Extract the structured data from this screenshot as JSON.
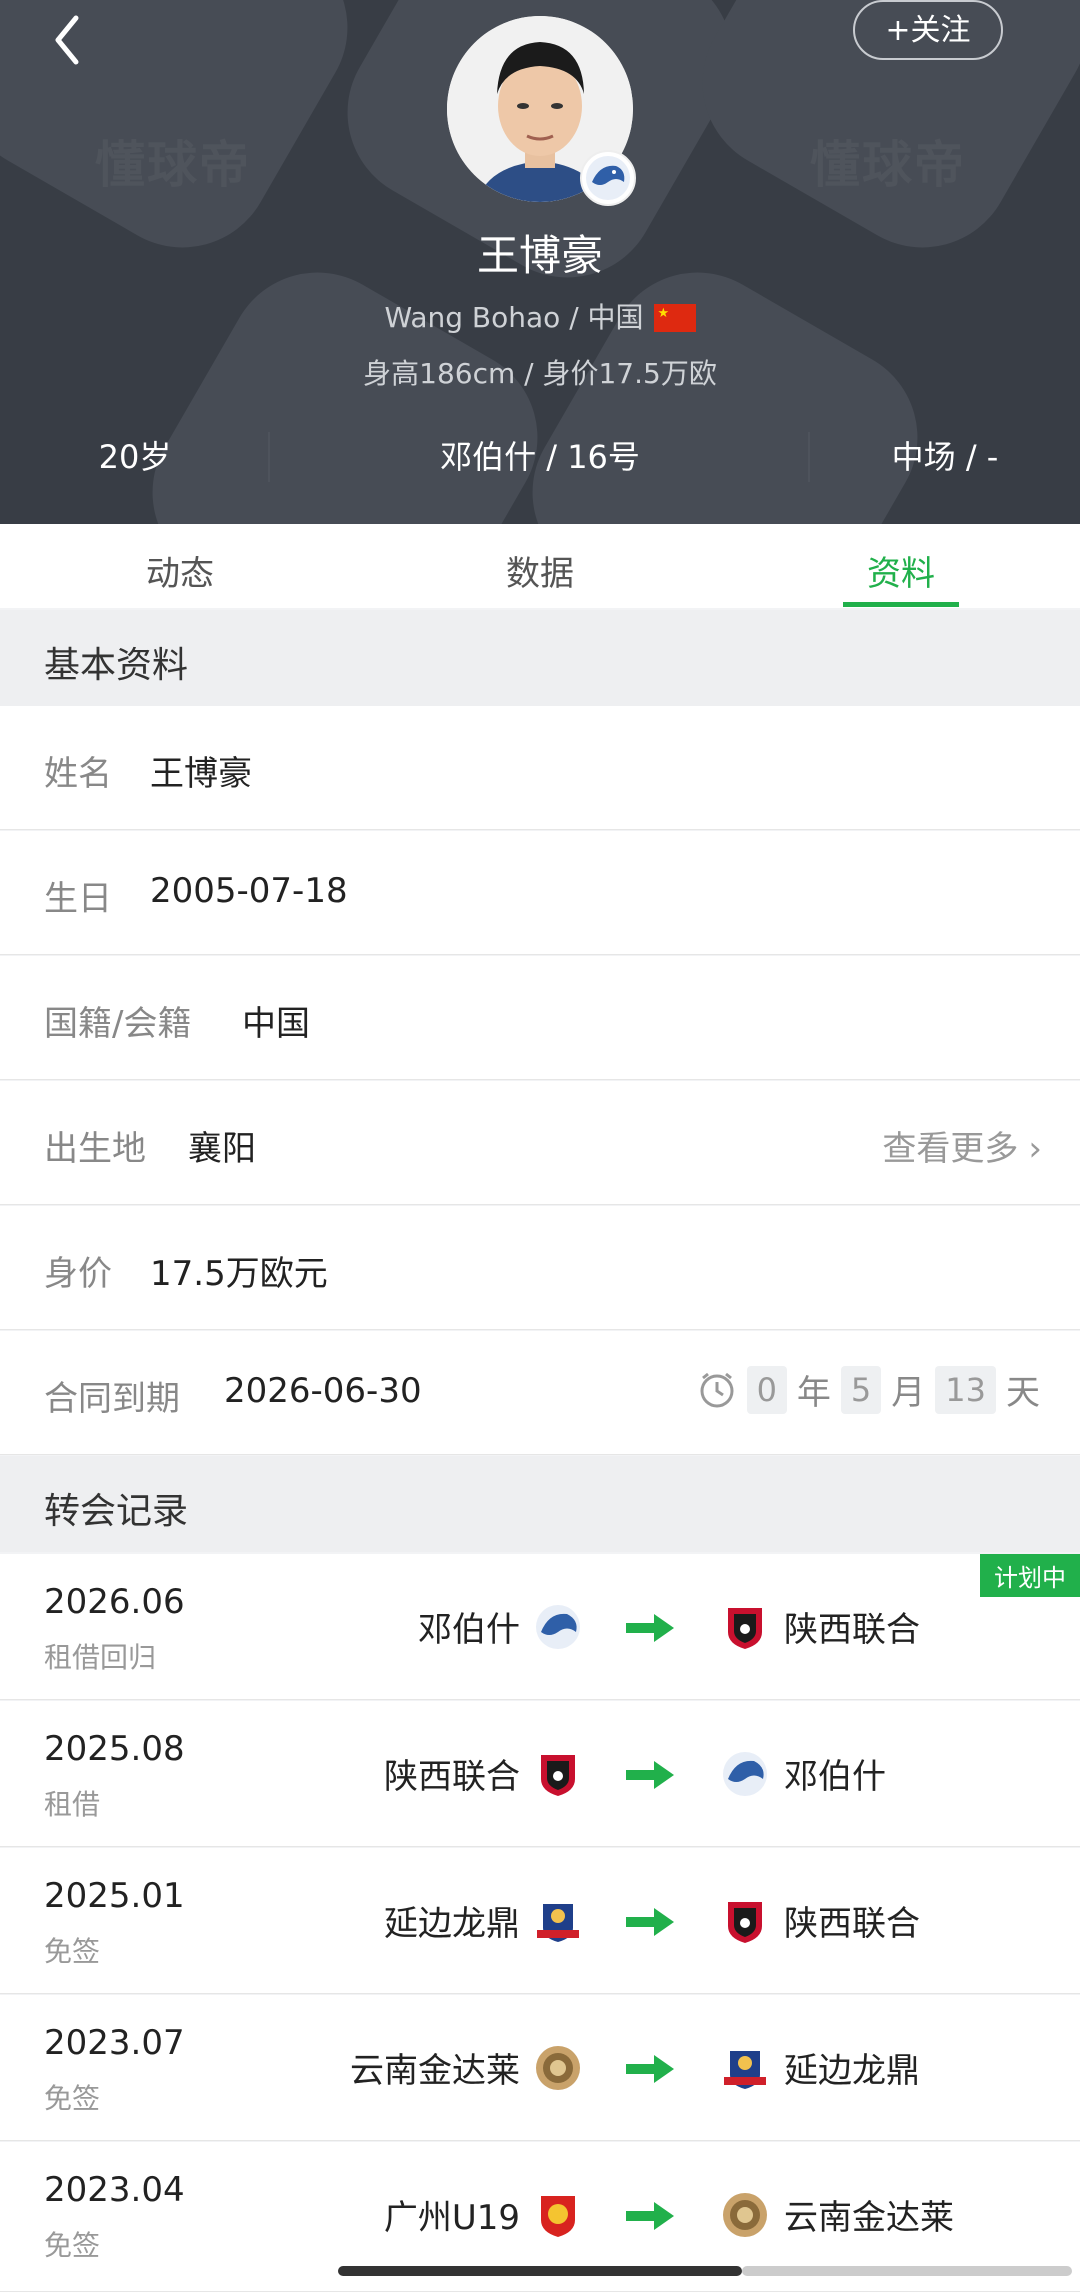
{
  "header": {
    "follow_label": "+关注",
    "watermark": "懂球帝",
    "player_name": "王博豪",
    "name_en": "Wang Bohao",
    "nationality": "中国",
    "separator": " / ",
    "height_value": "身高186cm / 身价17.5万欧",
    "stats": [
      "20岁",
      "邓伯什 / 16号",
      "中场 / -"
    ]
  },
  "tabs": [
    {
      "label": "动态"
    },
    {
      "label": "数据"
    },
    {
      "label": "资料",
      "active": true
    }
  ],
  "basic": {
    "title": "基本资料",
    "rows": [
      {
        "label": "姓名",
        "value": "王博豪"
      },
      {
        "label": "生日",
        "value": "2005-07-18"
      },
      {
        "label": "国籍/会籍",
        "value": "中国"
      },
      {
        "label": "出生地",
        "value": "襄阳",
        "more": "查看更多"
      },
      {
        "label": "身价",
        "value": "17.5万欧元"
      },
      {
        "label": "合同到期",
        "value": "2026-06-30"
      }
    ],
    "countdown": {
      "years": "0",
      "year_unit": "年",
      "months": "5",
      "month_unit": "月",
      "days": "13",
      "day_unit": "天"
    }
  },
  "transfers": {
    "title": "转会记录",
    "plan_tag": "计划中",
    "items": [
      {
        "date": "2026.06",
        "type": "租借回归",
        "from": "邓伯什",
        "to": "陕西联合"
      },
      {
        "date": "2025.08",
        "type": "租借",
        "from": "陕西联合",
        "to": "邓伯什"
      },
      {
        "date": "2025.01",
        "type": "免签",
        "from": "延边龙鼎",
        "to": "陕西联合"
      },
      {
        "date": "2023.07",
        "type": "免签",
        "from": "云南金达莱",
        "to": "延边龙鼎"
      },
      {
        "date": "2023.04",
        "type": "免签",
        "from": "广州U19",
        "to": "云南金达莱"
      }
    ]
  },
  "colors": {
    "accent": "#21b04b",
    "header_bg": "#383d45"
  }
}
